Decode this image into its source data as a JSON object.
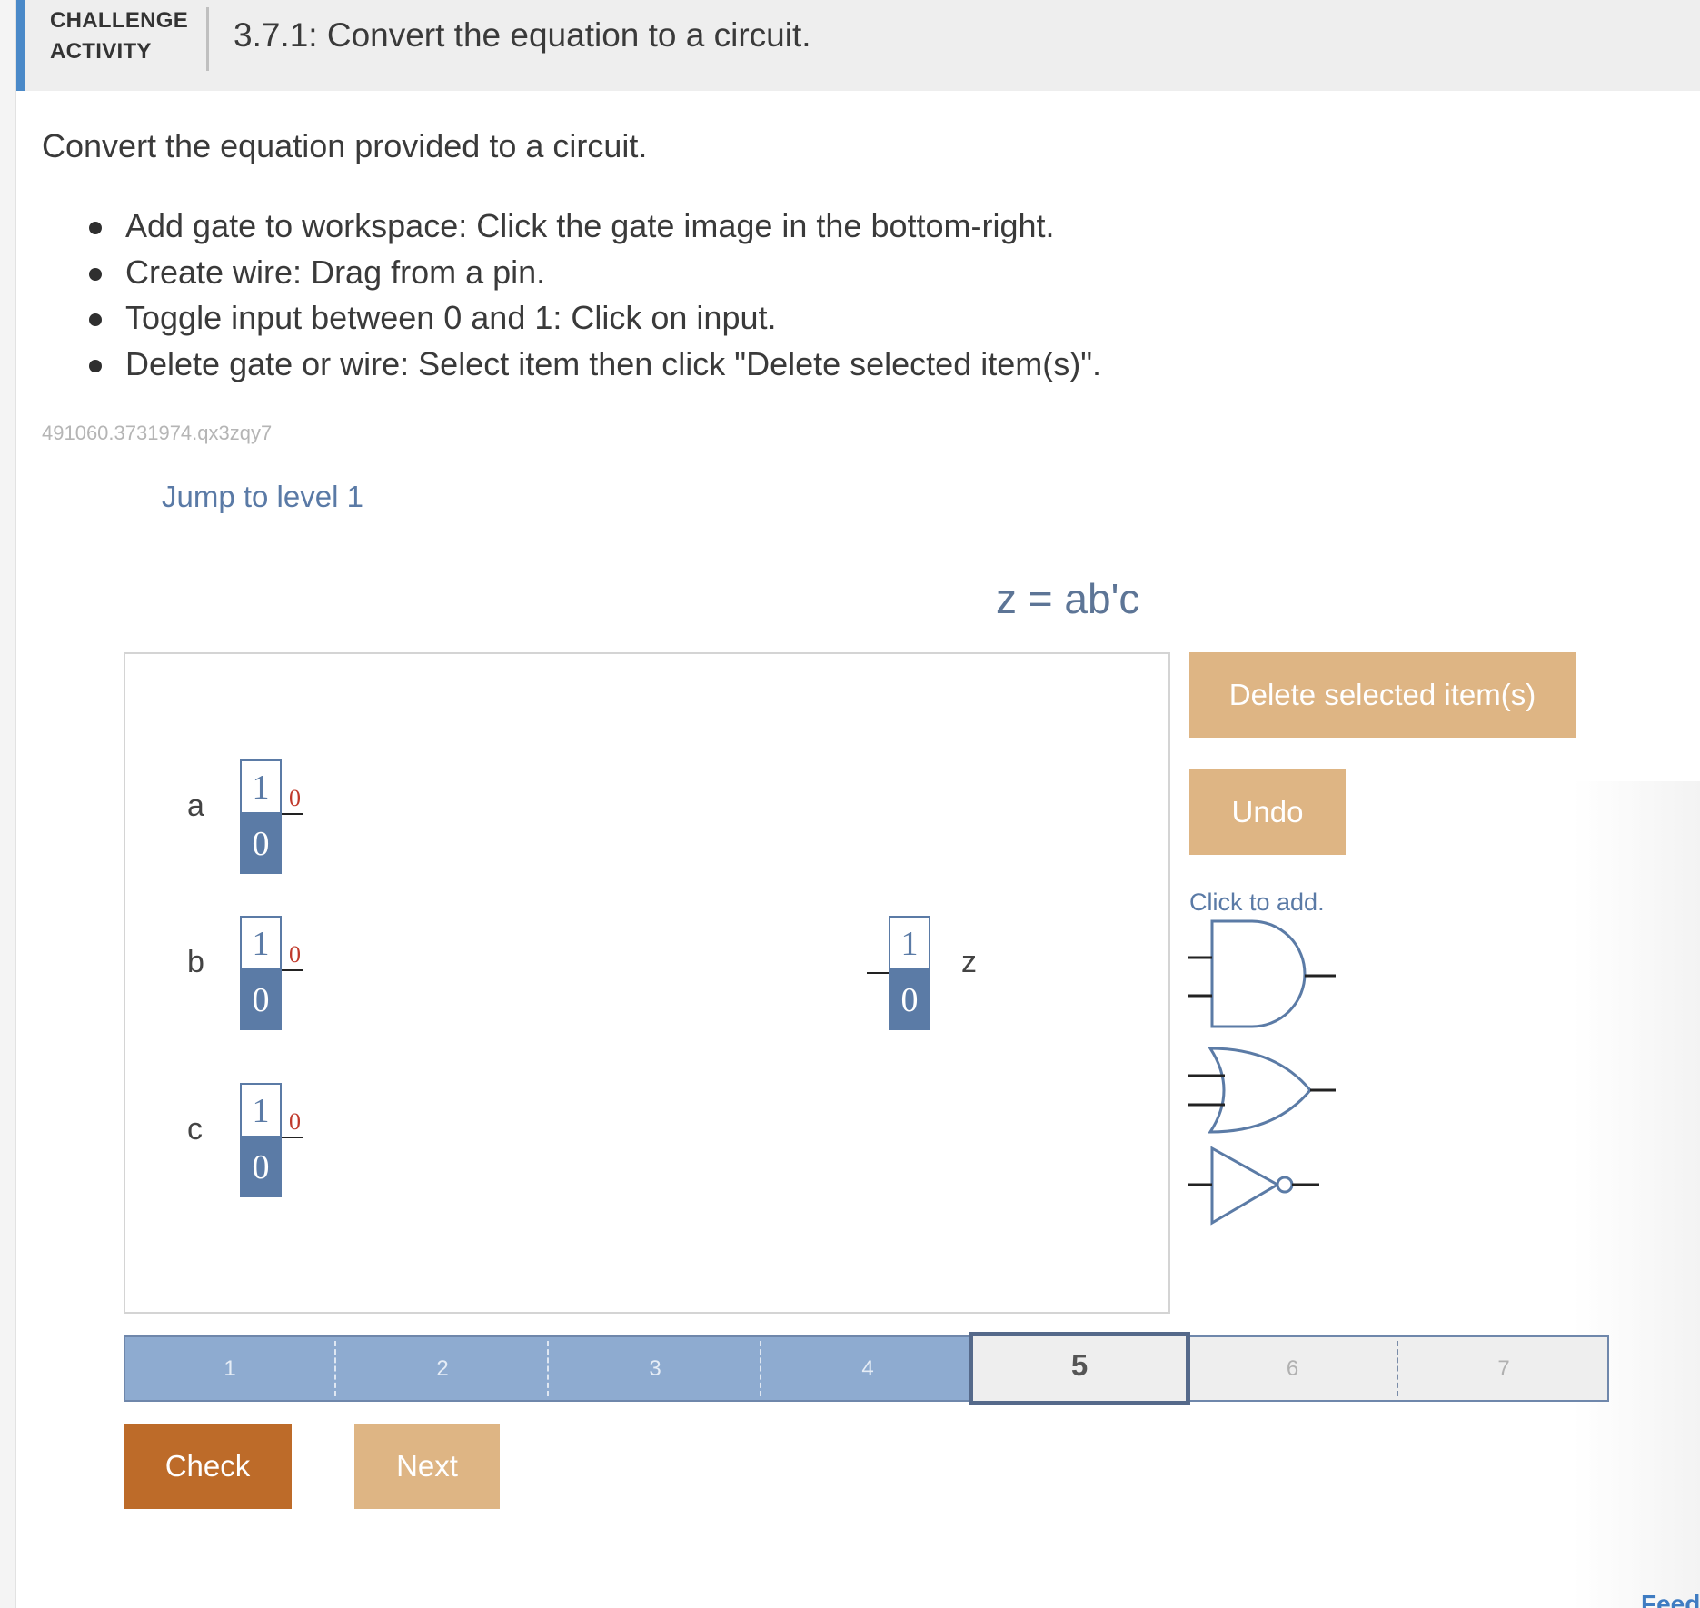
{
  "header": {
    "label_line1": "CHALLENGE",
    "label_line2": "ACTIVITY",
    "title": "3.7.1: Convert the equation to a circuit."
  },
  "instructions": {
    "intro": "Convert the equation provided to a circuit.",
    "bullets": [
      "Add gate to workspace: Click the gate image in the bottom-right.",
      "Create wire: Drag from a pin.",
      "Toggle input between 0 and 1: Click on input.",
      "Delete gate or wire: Select item then click \"Delete selected item(s)\"."
    ]
  },
  "activity_id": "491060.3731974.qx3zqy7",
  "jump_link": "Jump to level 1",
  "equation": "z = ab'c",
  "workspace": {
    "inputs": [
      {
        "label": "a",
        "top": "1",
        "bottom": "0",
        "pin_value": "0"
      },
      {
        "label": "b",
        "top": "1",
        "bottom": "0",
        "pin_value": "0"
      },
      {
        "label": "c",
        "top": "1",
        "bottom": "0",
        "pin_value": "0"
      }
    ],
    "output": {
      "label": "z",
      "top": "1",
      "bottom": "0"
    }
  },
  "tools": {
    "delete_label": "Delete selected item(s)",
    "undo_label": "Undo",
    "click_to_add": "Click to add.",
    "gates": [
      "and-gate-icon",
      "or-gate-icon",
      "not-gate-icon"
    ]
  },
  "levels": {
    "items": [
      "1",
      "2",
      "3",
      "4",
      "5",
      "6",
      "7"
    ],
    "current": 5,
    "completed": 4
  },
  "actions": {
    "check_label": "Check",
    "next_label": "Next"
  },
  "footer_link": "Feed",
  "colors": {
    "accent_blue": "#4a89c8",
    "toggle_blue": "#5b7ba6",
    "button_light": "#deb584",
    "button_check": "#bd6b29",
    "level_done": "#8eabd0"
  }
}
